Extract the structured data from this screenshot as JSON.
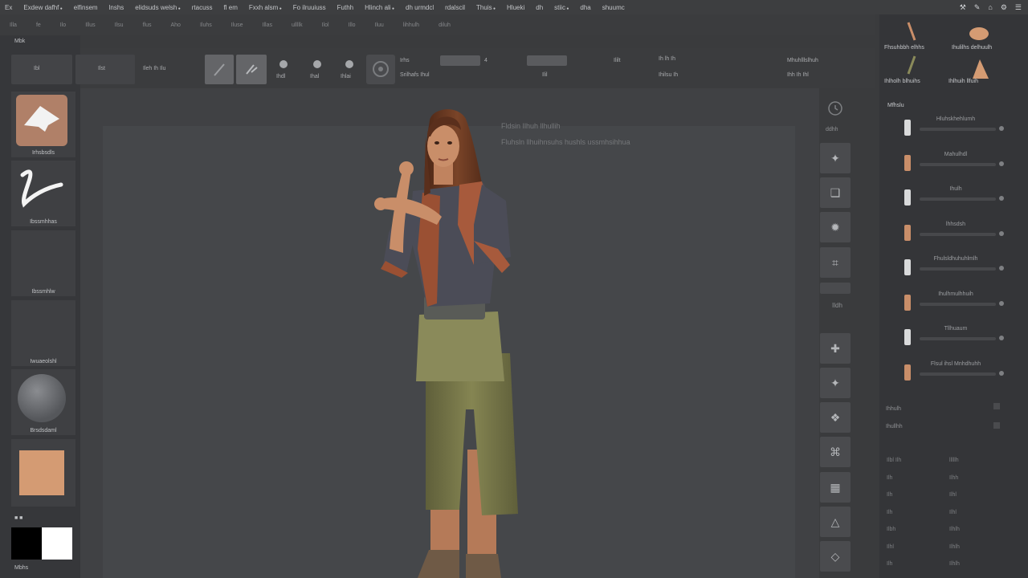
{
  "menubar": {
    "items": [
      "Ex",
      "Exdew dafhf",
      "elfinsem",
      "lnshs",
      "elidsuds welsh",
      "rtacuss",
      "fl em",
      "Fxxh alsm",
      "Fo ilruuiuss",
      "Futhh",
      "Hlinch ali",
      "dh urmdcl",
      "rdalscil",
      "Thuis",
      "Hlueki",
      "dh",
      "stiic",
      "dha",
      "shuumc"
    ],
    "sys_icons": [
      "⚒",
      "✎",
      "⌂",
      "⚙",
      "☰"
    ]
  },
  "submenu": {
    "items": [
      "Illa",
      "fe",
      "Ilo",
      "Illus",
      "Ilsu",
      "flus",
      "Aho",
      "Iluhs",
      "Iluse",
      "Illas",
      "ullllk",
      "Ilol",
      "Illo",
      "Iluu",
      "lihhulh",
      "diluh"
    ]
  },
  "left": {
    "section_title": "Mbk",
    "tiles": [
      {
        "label": "Irhsbsdls",
        "icon": "brush-thumb-icon"
      },
      {
        "label": "Ibssmhhas",
        "icon": "stroke-thumb-icon"
      },
      {
        "label": "Ibssmhlw",
        "icon": ""
      },
      {
        "label": "Iwuaeolshl",
        "icon": ""
      },
      {
        "label": "Brsdsdaml",
        "icon": "material-sphere-icon"
      },
      {
        "label": "",
        "icon": "color-swatch-icon"
      }
    ],
    "bottom_label": "Mbhs",
    "primary_color": "#000000",
    "secondary_color": "#ffffff",
    "swatch_color": "#d49b73"
  },
  "toolbar": {
    "btn1": "Ibl",
    "btn2": "Ilst",
    "btn3": "Ileh Ih Ilu",
    "draw_labels": [
      "Ihdl",
      "Ihal",
      "Ihlai"
    ],
    "field1_label": "Irhs",
    "field1_sub": "Srilhafs Ihul",
    "field2_label": "Ilil",
    "field3_label": "Ililt",
    "field4_label": "Ih lh Ih",
    "field4_sub": "Ihilsu Ih",
    "right_label": "Mhuhlllslhuh",
    "right_sub": "Ihh Ih Ihl"
  },
  "viewport": {
    "heading": "Fldsin Ilhuh llhullih",
    "subtext": "Fluhsln llhuihnsuhs hushls ussmhsihhua"
  },
  "right_dock": {
    "top_icon": "rotate-icon",
    "top_label": "ddhh",
    "icons": [
      "move-icon",
      "scale-icon",
      "rotate-icon",
      "frame-icon",
      "persp-icon",
      "floor-icon",
      "local-icon",
      "xyz-icon",
      "poly-icon",
      "transp-icon",
      "ghost-icon",
      "solo-icon"
    ],
    "mid_label": "Ildh"
  },
  "panel": {
    "top_titles": [
      "Fhsuhbbh elhhs",
      "Ihulilhs delhuulh"
    ],
    "bottom_titles": [
      "Ihlholh blhuihs",
      "Ihlhuih llfuih"
    ],
    "section": "Mfhslu",
    "rows": [
      "Hluhskhehlumh",
      "Mahulhdl",
      "Ihulh",
      "lhhsdsh",
      "Fhulsldhuhuhlmlh",
      "Ihulhmulhhuih",
      "Tllhuaum",
      "Flsul ihsl Mnhdhuhh"
    ],
    "extra_labels": [
      "Ihhulh",
      "Ihullhh"
    ],
    "grid": [
      "Ilbl Ilh",
      "lllllh",
      "Ilh",
      "Ilhh",
      "Ilh",
      "Ilhl",
      "Ilh",
      "Ilhl",
      "Ilbh",
      "Ilhlh",
      "Ilhl",
      "Ilhlh",
      "Ilh",
      "Ilhlh",
      "Ilhl"
    ]
  },
  "colors": {
    "skin": "#c98e69",
    "hair": "#6a3a22",
    "shirt": "#4b4c57",
    "sash": "#a75a3c",
    "pants": "#7a7a4b"
  }
}
